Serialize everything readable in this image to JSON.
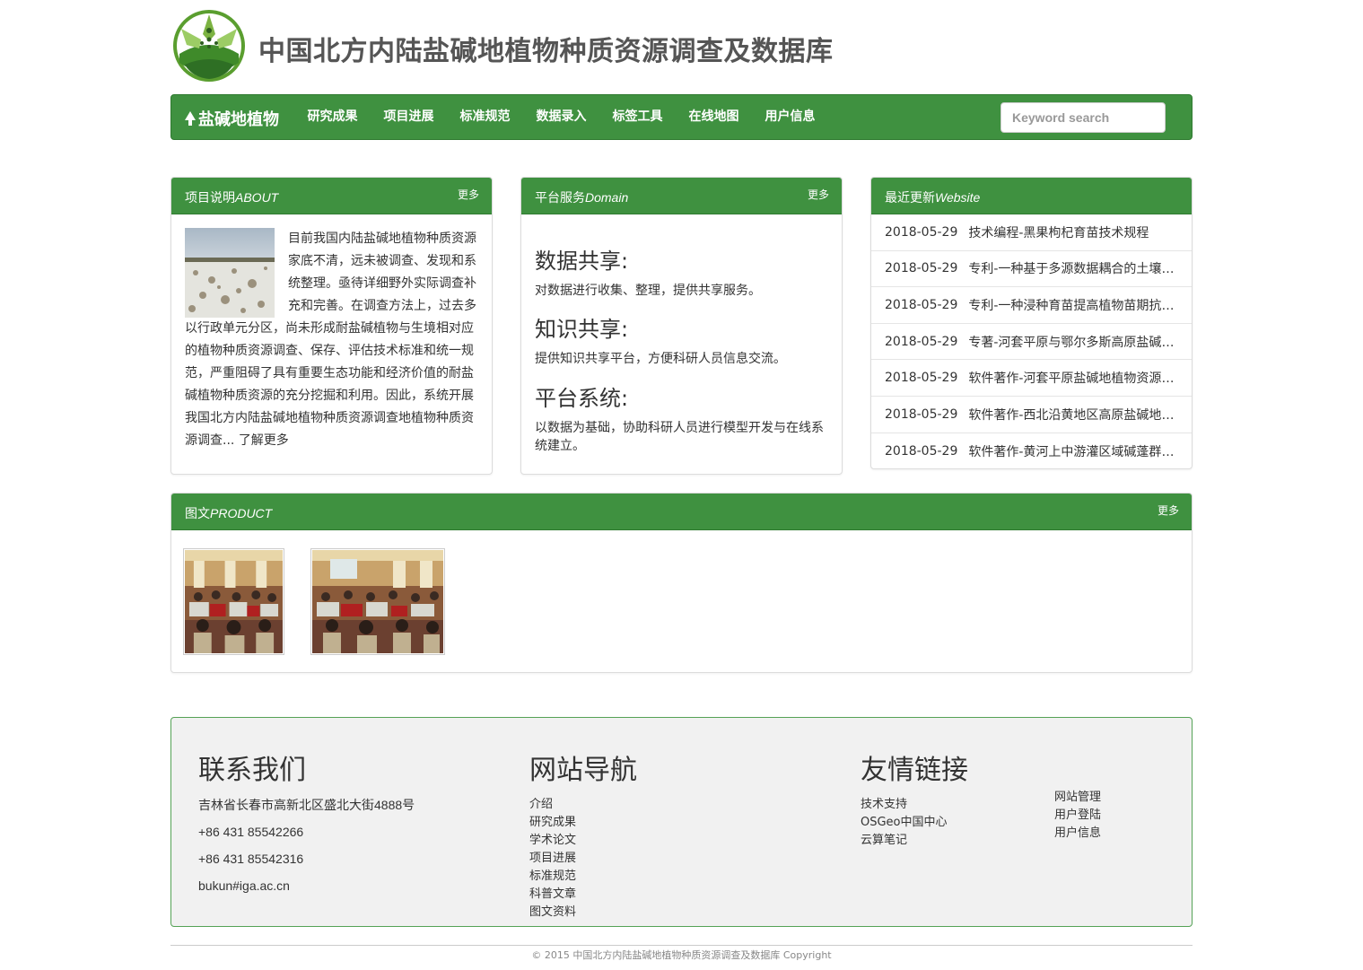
{
  "header": {
    "site_title": "中国北方内陆盐碱地植物种质资源调查及数据库"
  },
  "navbar": {
    "brand": "盐碱地植物",
    "items": [
      "研究成果",
      "项目进展",
      "标准规范",
      "数据录入",
      "标签工具",
      "在线地图",
      "用户信息"
    ],
    "search_placeholder": "Keyword search"
  },
  "about": {
    "title_cn": "项目说明",
    "title_en": "ABOUT",
    "more": "更多",
    "text": "目前我国内陆盐碱地植物种质资源家底不清，远未被调查、发现和系统整理。亟待详细野外实际调查补充和完善。在调查方法上，过去多以行政单元分区，尚未形成耐盐碱植物与生境相对应的植物种质资源调查、保存、评估技术标准和统一规范，严重阻碍了具有重要生态功能和经济价值的耐盐碱植物种质资源的充分挖掘和利用。因此，系统开展我国北方内陆盐碱地植物种质资源调查地植物种质资源调查...",
    "read_more": "了解更多"
  },
  "services": {
    "title_cn": "平台服务",
    "title_en": "Domain",
    "more": "更多",
    "items": [
      {
        "heading": "数据共享:",
        "text": "对数据进行收集、整理，提供共享服务。"
      },
      {
        "heading": "知识共享:",
        "text": "提供知识共享平台，方便科研人员信息交流。"
      },
      {
        "heading": "平台系统:",
        "text": "以数据为基础，协助科研人员进行模型开发与在线系统建立。"
      }
    ]
  },
  "recent": {
    "title_cn": "最近更新",
    "title_en": "Website",
    "items": [
      {
        "date": "2018-05-29",
        "title": "技术编程-黑果枸杞育苗技术规程"
      },
      {
        "date": "2018-05-29",
        "title": "专利-一种基于多源数据耦合的土壤盐渍化信息提取方法"
      },
      {
        "date": "2018-05-29",
        "title": "专利-一种浸种育苗提高植物苗期抗盐性的方法"
      },
      {
        "date": "2018-05-29",
        "title": "专著-河套平原与鄂尔多斯高原盐碱地植物图谱"
      },
      {
        "date": "2018-05-29",
        "title": "软件著作-河套平原盐碱地植物资源识别系统"
      },
      {
        "date": "2018-05-29",
        "title": "软件著作-西北沿黄地区高原盐碱地植物数据库系统"
      },
      {
        "date": "2018-05-29",
        "title": "软件著作-黄河上中游灌区域碱蓬群落分布系统"
      }
    ]
  },
  "product": {
    "title_cn": "图文",
    "title_en": "PRODUCT",
    "more": "更多"
  },
  "footer": {
    "contact": {
      "heading": "联系我们",
      "lines": [
        "吉林省长春市高新北区盛北大街4888号",
        "+86 431 85542266",
        "+86 431 85542316",
        "bukun#iga.ac.cn"
      ]
    },
    "nav": {
      "heading": "网站导航",
      "links": [
        "介绍",
        "研究成果",
        "学术论文",
        "项目进展",
        "标准规范",
        "科普文章",
        "图文资料"
      ]
    },
    "friends": {
      "heading": "友情链接",
      "links_a": [
        "技术支持",
        "OSGeo中国中心",
        "云算笔记"
      ],
      "links_b": [
        "网站管理",
        "用户登陆",
        "用户信息"
      ]
    }
  },
  "copyright": "© 2015 中国北方内陆盐碱地植物种质资源调查及数据库 Copyright",
  "colors": {
    "brand_green": "#3f9140",
    "footer_bg": "#f1f1f1"
  }
}
